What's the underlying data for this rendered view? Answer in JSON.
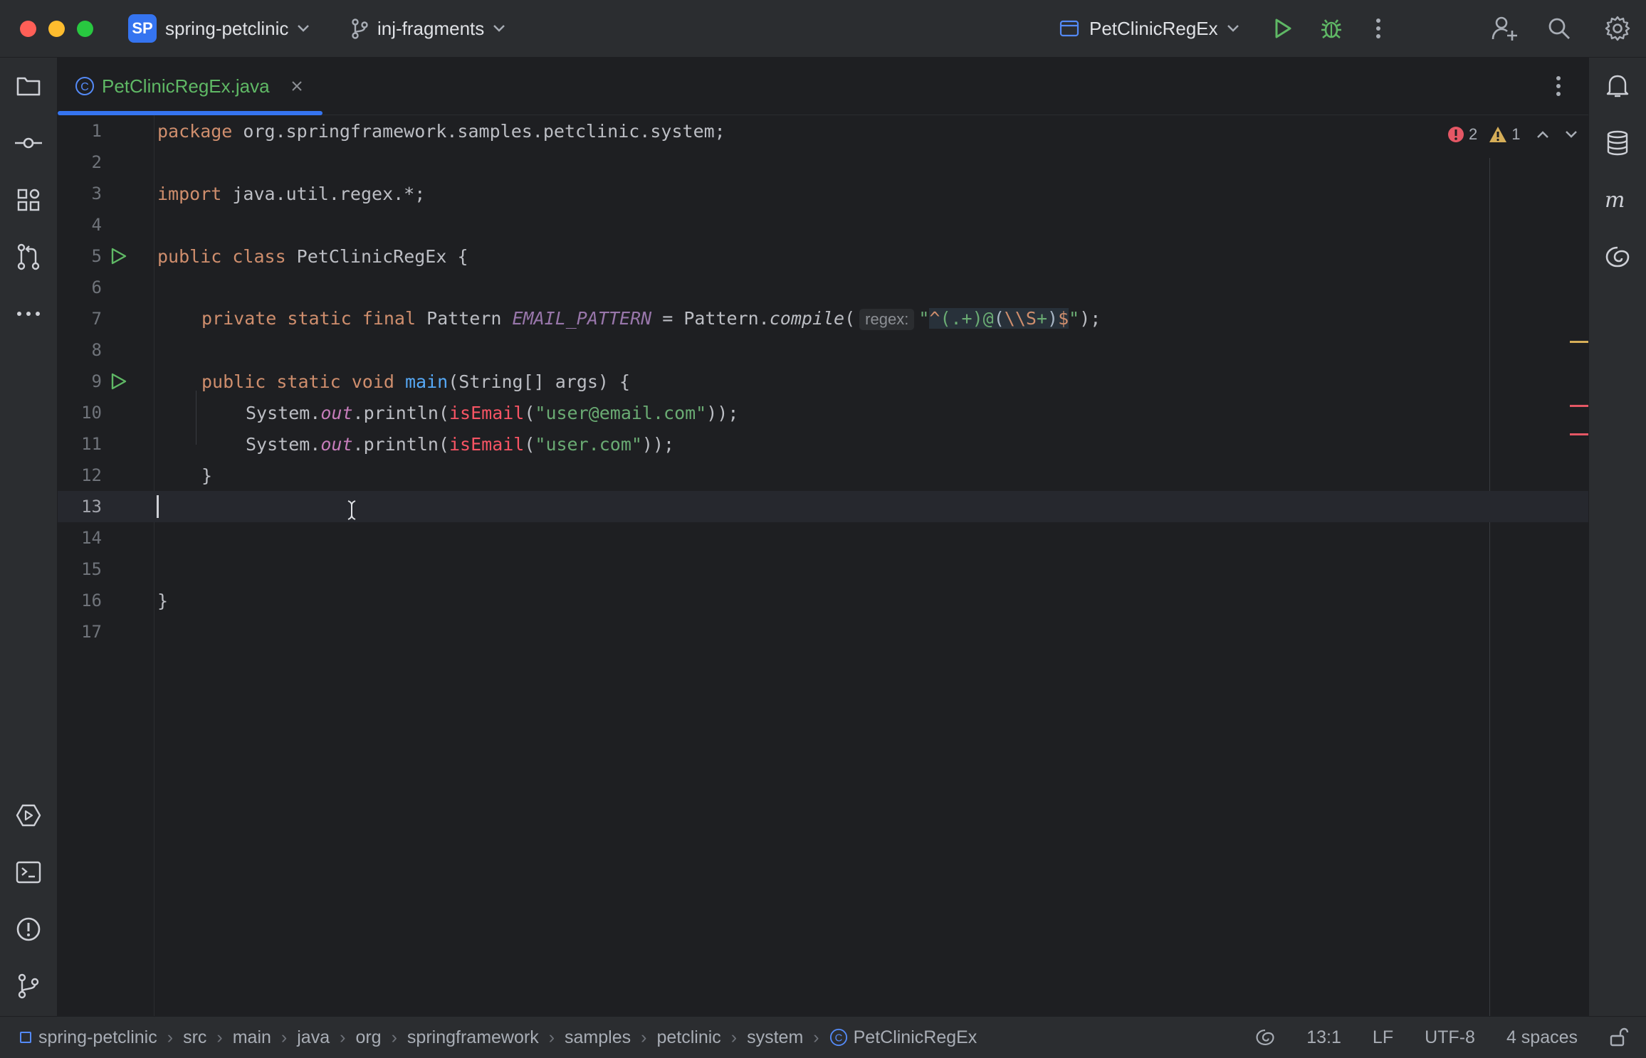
{
  "window": {
    "project_badge": "SP",
    "project_name": "spring-petclinic",
    "branch": "inj-fragments",
    "run_config": "PetClinicRegEx"
  },
  "tab": {
    "icon_letter": "C",
    "label": "PetClinicRegEx.java"
  },
  "inspections": {
    "errors": "2",
    "warnings": "1"
  },
  "editor": {
    "lines": [
      "1",
      "2",
      "3",
      "4",
      "5",
      "6",
      "7",
      "8",
      "9",
      "10",
      "11",
      "12",
      "13",
      "14",
      "15",
      "16",
      "17"
    ],
    "code": {
      "l1_kw": "package",
      "l1_rest": " org.springframework.samples.petclinic.system;",
      "l3_kw": "import",
      "l3_rest": " java.util.regex.*;",
      "l5_kw": "public class",
      "l5_rest": " PetClinicRegEx {",
      "l7_kw": "private static final",
      "l7_type": " Pattern ",
      "l7_const": "EMAIL_PATTERN",
      "l7_eq": " = Pattern.",
      "l7_method": "compile",
      "l7_paren": "(",
      "l7_hint": "regex:",
      "l7_q1": "\"",
      "l7_caret": "^",
      "l7_g1": "(.+)",
      "l7_at": "@",
      "l7_g2o": "(",
      "l7_esc": "\\\\S",
      "l7_plus": "+",
      "l7_g2c": ")",
      "l7_dollar": "$",
      "l7_q2": "\"",
      "l7_end": ");",
      "l9_kw": "public static void",
      "l9_fn": "main",
      "l9_rest": "(String[] args) {",
      "l10_a": "System.",
      "l10_out": "out",
      "l10_b": ".println(",
      "l10_call": "isEmail",
      "l10_c": "(",
      "l10_str": "\"user@email.com\"",
      "l10_d": "));",
      "l11_a": "System.",
      "l11_out": "out",
      "l11_b": ".println(",
      "l11_call": "isEmail",
      "l11_c": "(",
      "l11_str": "\"user.com\"",
      "l11_d": "));",
      "l12": "}",
      "l16": "}"
    },
    "current_line": 13
  },
  "statusbar": {
    "breadcrumbs": [
      "spring-petclinic",
      "src",
      "main",
      "java",
      "org",
      "springframework",
      "samples",
      "petclinic",
      "system",
      "PetClinicRegEx"
    ],
    "position": "13:1",
    "line_sep": "LF",
    "encoding": "UTF-8",
    "indent": "4 spaces"
  },
  "colors": {
    "accent": "#3574F0",
    "run_green": "#5FB865",
    "error_red": "#E55765",
    "warning_yellow": "#D6AE58"
  },
  "icons": {
    "left_top": [
      "folder-icon",
      "commit-icon",
      "structure-icon",
      "pull-requests-icon",
      "more-icon"
    ],
    "left_bottom": [
      "services-icon",
      "terminal-icon",
      "problems-icon",
      "git-icon"
    ],
    "right": [
      "notifications-icon",
      "database-icon",
      "maven-icon",
      "ai-assistant-icon"
    ]
  }
}
